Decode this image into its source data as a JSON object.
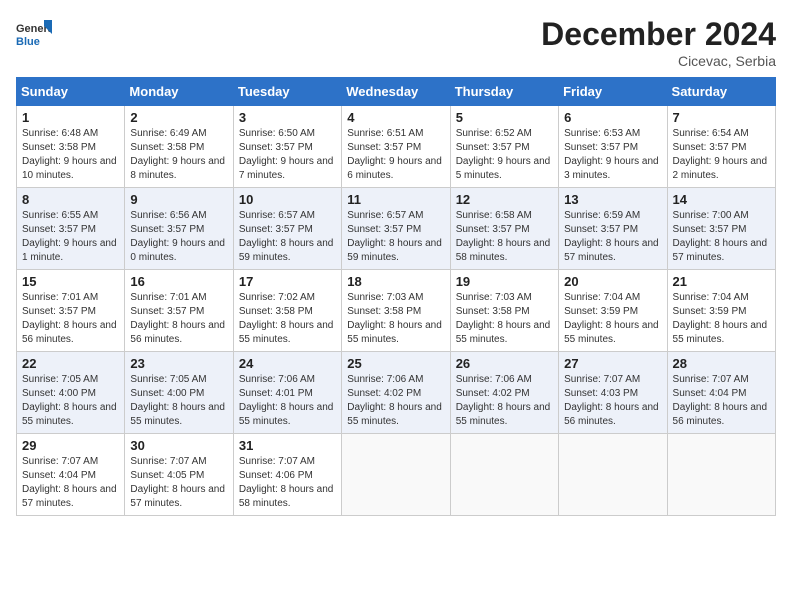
{
  "header": {
    "logo_general": "General",
    "logo_blue": "Blue",
    "month_title": "December 2024",
    "location": "Cicevac, Serbia"
  },
  "days_of_week": [
    "Sunday",
    "Monday",
    "Tuesday",
    "Wednesday",
    "Thursday",
    "Friday",
    "Saturday"
  ],
  "weeks": [
    [
      {
        "day": "1",
        "sunrise": "Sunrise: 6:48 AM",
        "sunset": "Sunset: 3:58 PM",
        "daylight": "Daylight: 9 hours and 10 minutes."
      },
      {
        "day": "2",
        "sunrise": "Sunrise: 6:49 AM",
        "sunset": "Sunset: 3:58 PM",
        "daylight": "Daylight: 9 hours and 8 minutes."
      },
      {
        "day": "3",
        "sunrise": "Sunrise: 6:50 AM",
        "sunset": "Sunset: 3:57 PM",
        "daylight": "Daylight: 9 hours and 7 minutes."
      },
      {
        "day": "4",
        "sunrise": "Sunrise: 6:51 AM",
        "sunset": "Sunset: 3:57 PM",
        "daylight": "Daylight: 9 hours and 6 minutes."
      },
      {
        "day": "5",
        "sunrise": "Sunrise: 6:52 AM",
        "sunset": "Sunset: 3:57 PM",
        "daylight": "Daylight: 9 hours and 5 minutes."
      },
      {
        "day": "6",
        "sunrise": "Sunrise: 6:53 AM",
        "sunset": "Sunset: 3:57 PM",
        "daylight": "Daylight: 9 hours and 3 minutes."
      },
      {
        "day": "7",
        "sunrise": "Sunrise: 6:54 AM",
        "sunset": "Sunset: 3:57 PM",
        "daylight": "Daylight: 9 hours and 2 minutes."
      }
    ],
    [
      {
        "day": "8",
        "sunrise": "Sunrise: 6:55 AM",
        "sunset": "Sunset: 3:57 PM",
        "daylight": "Daylight: 9 hours and 1 minute."
      },
      {
        "day": "9",
        "sunrise": "Sunrise: 6:56 AM",
        "sunset": "Sunset: 3:57 PM",
        "daylight": "Daylight: 9 hours and 0 minutes."
      },
      {
        "day": "10",
        "sunrise": "Sunrise: 6:57 AM",
        "sunset": "Sunset: 3:57 PM",
        "daylight": "Daylight: 8 hours and 59 minutes."
      },
      {
        "day": "11",
        "sunrise": "Sunrise: 6:57 AM",
        "sunset": "Sunset: 3:57 PM",
        "daylight": "Daylight: 8 hours and 59 minutes."
      },
      {
        "day": "12",
        "sunrise": "Sunrise: 6:58 AM",
        "sunset": "Sunset: 3:57 PM",
        "daylight": "Daylight: 8 hours and 58 minutes."
      },
      {
        "day": "13",
        "sunrise": "Sunrise: 6:59 AM",
        "sunset": "Sunset: 3:57 PM",
        "daylight": "Daylight: 8 hours and 57 minutes."
      },
      {
        "day": "14",
        "sunrise": "Sunrise: 7:00 AM",
        "sunset": "Sunset: 3:57 PM",
        "daylight": "Daylight: 8 hours and 57 minutes."
      }
    ],
    [
      {
        "day": "15",
        "sunrise": "Sunrise: 7:01 AM",
        "sunset": "Sunset: 3:57 PM",
        "daylight": "Daylight: 8 hours and 56 minutes."
      },
      {
        "day": "16",
        "sunrise": "Sunrise: 7:01 AM",
        "sunset": "Sunset: 3:57 PM",
        "daylight": "Daylight: 8 hours and 56 minutes."
      },
      {
        "day": "17",
        "sunrise": "Sunrise: 7:02 AM",
        "sunset": "Sunset: 3:58 PM",
        "daylight": "Daylight: 8 hours and 55 minutes."
      },
      {
        "day": "18",
        "sunrise": "Sunrise: 7:03 AM",
        "sunset": "Sunset: 3:58 PM",
        "daylight": "Daylight: 8 hours and 55 minutes."
      },
      {
        "day": "19",
        "sunrise": "Sunrise: 7:03 AM",
        "sunset": "Sunset: 3:58 PM",
        "daylight": "Daylight: 8 hours and 55 minutes."
      },
      {
        "day": "20",
        "sunrise": "Sunrise: 7:04 AM",
        "sunset": "Sunset: 3:59 PM",
        "daylight": "Daylight: 8 hours and 55 minutes."
      },
      {
        "day": "21",
        "sunrise": "Sunrise: 7:04 AM",
        "sunset": "Sunset: 3:59 PM",
        "daylight": "Daylight: 8 hours and 55 minutes."
      }
    ],
    [
      {
        "day": "22",
        "sunrise": "Sunrise: 7:05 AM",
        "sunset": "Sunset: 4:00 PM",
        "daylight": "Daylight: 8 hours and 55 minutes."
      },
      {
        "day": "23",
        "sunrise": "Sunrise: 7:05 AM",
        "sunset": "Sunset: 4:00 PM",
        "daylight": "Daylight: 8 hours and 55 minutes."
      },
      {
        "day": "24",
        "sunrise": "Sunrise: 7:06 AM",
        "sunset": "Sunset: 4:01 PM",
        "daylight": "Daylight: 8 hours and 55 minutes."
      },
      {
        "day": "25",
        "sunrise": "Sunrise: 7:06 AM",
        "sunset": "Sunset: 4:02 PM",
        "daylight": "Daylight: 8 hours and 55 minutes."
      },
      {
        "day": "26",
        "sunrise": "Sunrise: 7:06 AM",
        "sunset": "Sunset: 4:02 PM",
        "daylight": "Daylight: 8 hours and 55 minutes."
      },
      {
        "day": "27",
        "sunrise": "Sunrise: 7:07 AM",
        "sunset": "Sunset: 4:03 PM",
        "daylight": "Daylight: 8 hours and 56 minutes."
      },
      {
        "day": "28",
        "sunrise": "Sunrise: 7:07 AM",
        "sunset": "Sunset: 4:04 PM",
        "daylight": "Daylight: 8 hours and 56 minutes."
      }
    ],
    [
      {
        "day": "29",
        "sunrise": "Sunrise: 7:07 AM",
        "sunset": "Sunset: 4:04 PM",
        "daylight": "Daylight: 8 hours and 57 minutes."
      },
      {
        "day": "30",
        "sunrise": "Sunrise: 7:07 AM",
        "sunset": "Sunset: 4:05 PM",
        "daylight": "Daylight: 8 hours and 57 minutes."
      },
      {
        "day": "31",
        "sunrise": "Sunrise: 7:07 AM",
        "sunset": "Sunset: 4:06 PM",
        "daylight": "Daylight: 8 hours and 58 minutes."
      },
      null,
      null,
      null,
      null
    ]
  ]
}
